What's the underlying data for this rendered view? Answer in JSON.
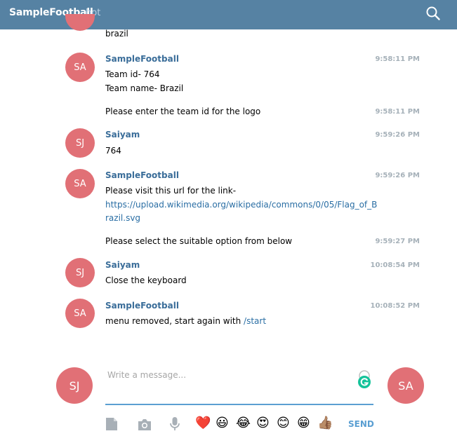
{
  "header": {
    "title": "SampleFootball",
    "subtitle": "bot",
    "search_icon": "search-icon"
  },
  "messages": [
    {
      "avatar": "",
      "lines": [
        "brazil"
      ]
    },
    {
      "avatar": "SA",
      "author": "SampleFootball",
      "time": "9:58:11 PM",
      "lines": [
        "Team id- 764",
        "Team name- Brazil"
      ]
    },
    {
      "time": "9:58:11 PM",
      "lines": [
        "Please enter the team id for the logo"
      ]
    },
    {
      "avatar": "SJ",
      "author": "Saiyam",
      "time": "9:59:26 PM",
      "lines": [
        "764"
      ]
    },
    {
      "avatar": "SA",
      "author": "SampleFootball",
      "time": "9:59:26 PM",
      "lines": [
        "Please visit this url for the link-"
      ],
      "link_lines": [
        "https://upload.wikimedia.org/wikipedia/commons/0/05/Flag_of_B",
        "razil.svg"
      ]
    },
    {
      "time": "9:59:27 PM",
      "lines": [
        "Please select the suitable option from below"
      ]
    },
    {
      "avatar": "SJ",
      "author": "Saiyam",
      "time": "10:08:54 PM",
      "lines": [
        "Close the keyboard"
      ]
    },
    {
      "avatar": "SA",
      "author": "SampleFootball",
      "time": "10:08:52 PM",
      "text_before_link": "menu removed, start again with ",
      "command": "/start"
    }
  ],
  "composer": {
    "self_avatar": "SJ",
    "peer_avatar": "SA",
    "placeholder": "Write a message...",
    "send_label": "SEND",
    "emojis": [
      "❤️",
      "😃",
      "😂",
      "😍",
      "😊",
      "😁",
      "👍🏽"
    ]
  },
  "colors": {
    "header_bg": "#5682a3",
    "avatar_bg": "#e17076",
    "author": "#3a6d99",
    "link": "#2a6ea4",
    "accent": "#5b9fd2"
  }
}
